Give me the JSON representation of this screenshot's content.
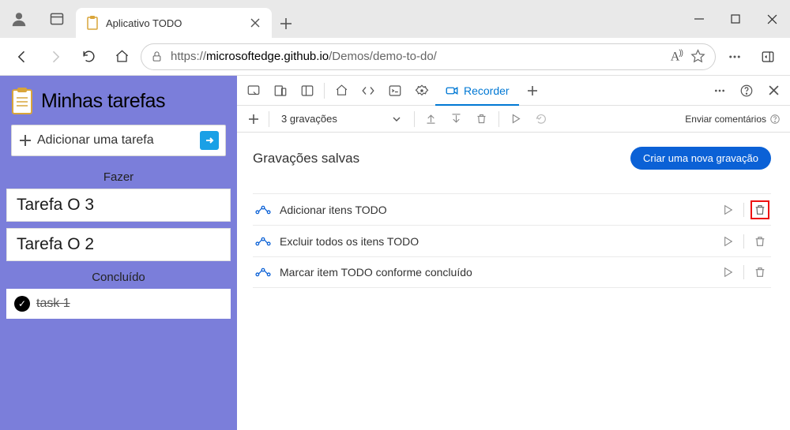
{
  "window": {
    "tab_title": "Aplicativo TODO"
  },
  "address": {
    "scheme": "https://",
    "host": "microsoftedge.github.io",
    "path": "/Demos/demo-to-do/"
  },
  "todo": {
    "title": "Minhas tarefas",
    "add_placeholder": "Adicionar uma tarefa",
    "section_todo": "Fazer",
    "section_done": "Concluído",
    "tasks": {
      "t0": "Tarefa O 3",
      "t1": "Tarefa O 2"
    },
    "done": {
      "d0": "task 1"
    }
  },
  "devtools": {
    "recorder_tab": "Recorder",
    "dropdown": "3 gravações",
    "feedback": "Enviar comentários",
    "section_title": "Gravações salvas",
    "new_recording": "Criar uma nova gravação",
    "recordings": {
      "r0": "Adicionar itens TODO",
      "r1": "Excluir todos os itens TODO",
      "r2": "Marcar item TODO conforme concluído"
    }
  }
}
